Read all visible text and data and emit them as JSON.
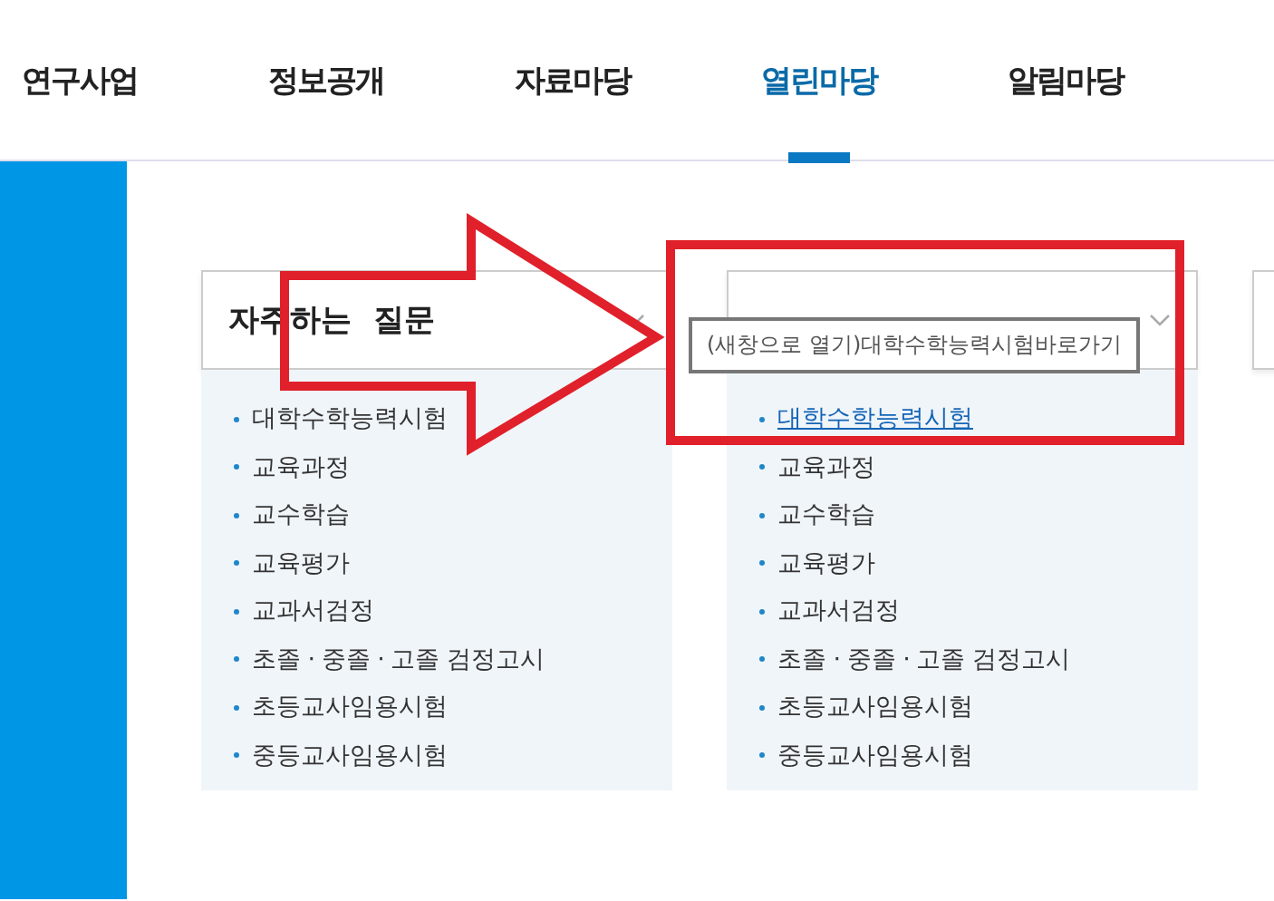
{
  "nav": [
    {
      "label": "연구사업",
      "selected": false
    },
    {
      "label": "정보공개",
      "selected": false
    },
    {
      "label": "자료마당",
      "selected": false
    },
    {
      "label": "열린마당",
      "selected": true
    },
    {
      "label": "알림마당",
      "selected": false
    }
  ],
  "cards": [
    {
      "title": "자주하는  질문",
      "items": [
        {
          "label": "대학수학능력시험",
          "hovered": false
        },
        {
          "label": "교육과정",
          "hovered": false
        },
        {
          "label": "교수학습",
          "hovered": false
        },
        {
          "label": "교육평가",
          "hovered": false
        },
        {
          "label": "교과서검정",
          "hovered": false
        },
        {
          "label": "초졸 · 중졸 · 고졸 검정고시",
          "hovered": false
        },
        {
          "label": "초등교사임용시험",
          "hovered": false
        },
        {
          "label": "중등교사임용시험",
          "hovered": false
        }
      ]
    },
    {
      "items": [
        {
          "label": "대학수학능력시험",
          "hovered": true
        },
        {
          "label": "교육과정",
          "hovered": false
        },
        {
          "label": "교수학습",
          "hovered": false
        },
        {
          "label": "교육평가",
          "hovered": false
        },
        {
          "label": "교과서검정",
          "hovered": false
        },
        {
          "label": "초졸 · 중졸 · 고졸 검정고시",
          "hovered": false
        },
        {
          "label": "초등교사임용시험",
          "hovered": false
        },
        {
          "label": "중등교사임용시험",
          "hovered": false
        }
      ]
    }
  ],
  "tooltip": "(새창으로 열기)대학수학능력시험바로가기"
}
